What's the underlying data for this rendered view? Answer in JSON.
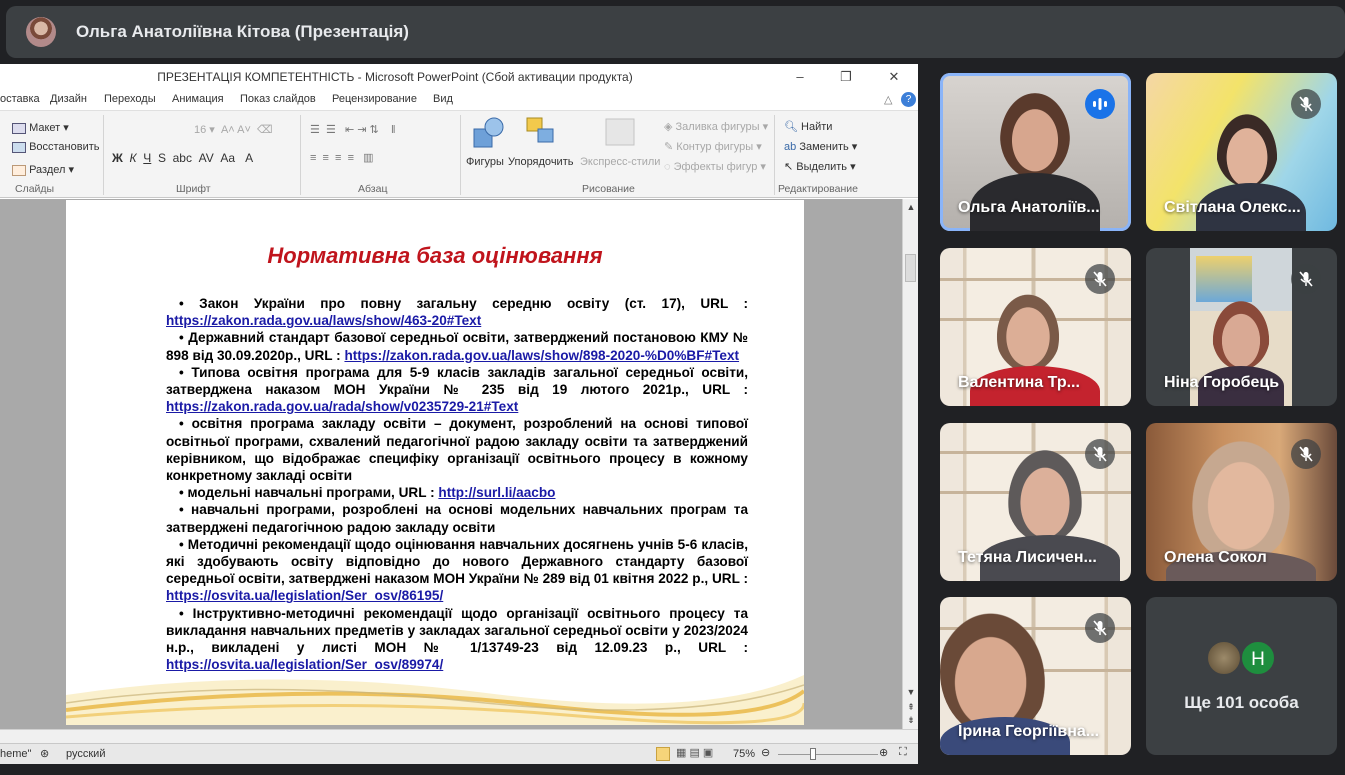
{
  "presenter": {
    "name": "Ольга Анатоліївна Кітова (Презентація)"
  },
  "ppt": {
    "window_title": "ПРЕЗЕНТАЦІЯ  КОМПЕТЕНТНІСТЬ - Microsoft PowerPoint (Сбой активации продукта)",
    "menu": [
      "оставка",
      "Дизайн",
      "Переходы",
      "Анимация",
      "Показ слайдов",
      "Рецензирование",
      "Вид"
    ],
    "ribbon": {
      "slides": {
        "layout": "Макет",
        "reset": "Восстановить",
        "section": "Раздел",
        "group": "Слайды"
      },
      "font": {
        "size": "16",
        "group": "Шрифт"
      },
      "paragraph": {
        "group": "Абзац"
      },
      "drawing": {
        "shapes": "Фигуры",
        "arrange": "Упорядочить",
        "quick_styles": "Экспресс-стили",
        "fill": "Заливка фигуры",
        "outline": "Контур фигуры",
        "effects": "Эффекты фигур",
        "group": "Рисование"
      },
      "editing": {
        "find": "Найти",
        "replace": "Заменить",
        "select": "Выделить",
        "group": "Редактирование"
      }
    },
    "status": {
      "theme": "heme\"",
      "language": "русский",
      "zoom": "75%"
    }
  },
  "slide": {
    "title": "Нормативна база оцінювання",
    "items": [
      {
        "text": "• Закон України про повну загальну середню освіту (ст. 17), URL : ",
        "link": "https://zakon.rada.gov.ua/laws/show/463-20#Text"
      },
      {
        "text": "• Державний стандарт базової середньої освіти, затверджений постановою КМУ № 898 від 30.09.2020р., URL : ",
        "link": "https://zakon.rada.gov.ua/laws/show/898-2020-%D0%BF#Text"
      },
      {
        "text": "• Типова освітня програма для 5-9 класів закладів загальної середньої освіти, затверджена наказом МОН України № 235 від 19 лютого 2021р., URL : ",
        "link": "https://zakon.rada.gov.ua/rada/show/v0235729-21#Text"
      },
      {
        "text": "• освітня програма закладу освіти – документ, розроблений на основі типової освітньої програми, схвалений педагогічної радою закладу освіти та затверджений керівником, що відображає специфіку організації освітнього процесу в кожному конкретному закладі освіти",
        "link": ""
      },
      {
        "text": "• модельні навчальні програми,  URL :  ",
        "link": "http://surl.li/aacbo"
      },
      {
        "text": "• навчальні програми, розроблені на основі модельних навчальних програм та затверджені педагогічною радою закладу освіти",
        "link": ""
      },
      {
        "text": "• Методичні рекомендації щодо оцінювання навчальних досягнень учнів 5-6 класів, які здобувають освіту відповідно до нового Державного стандарту базової середньої освіти, затверджені наказом МОН України № 289 від 01 квітня 2022 р., URL : ",
        "link": "https://osvita.ua/legislation/Ser_osv/86195/"
      },
      {
        "text": "• Інструктивно-методичні рекомендації щодо організації освітнього процесу та викладання навчальних предметів у закладах загальної середньої освіти у 2023/2024 н.р., викладені у листі МОН № 1/13749-23 від 12.09.23 р., URL : ",
        "link": "https://osvita.ua/legislation/Ser_osv/89974/"
      }
    ]
  },
  "participants": [
    {
      "name": "Ольга Анатоліїв...",
      "mic": "speaking"
    },
    {
      "name": "Світлана Олекс...",
      "mic": "muted"
    },
    {
      "name": "Валентина Тр...",
      "mic": "muted"
    },
    {
      "name": "Ніна Горобець",
      "mic": "muted"
    },
    {
      "name": "Тетяна Лисичен...",
      "mic": "muted"
    },
    {
      "name": "Олена Сокол",
      "mic": "muted"
    },
    {
      "name": "Ірина Георгіївна...",
      "mic": "muted"
    }
  ],
  "more": {
    "label": "Ще 101 особа",
    "avatar_letter": "Н"
  },
  "colors": {
    "accent_blue": "#1a73e8",
    "active_border": "#8ab4f8",
    "slide_title": "#c0141c",
    "link": "#1a1aa6"
  }
}
